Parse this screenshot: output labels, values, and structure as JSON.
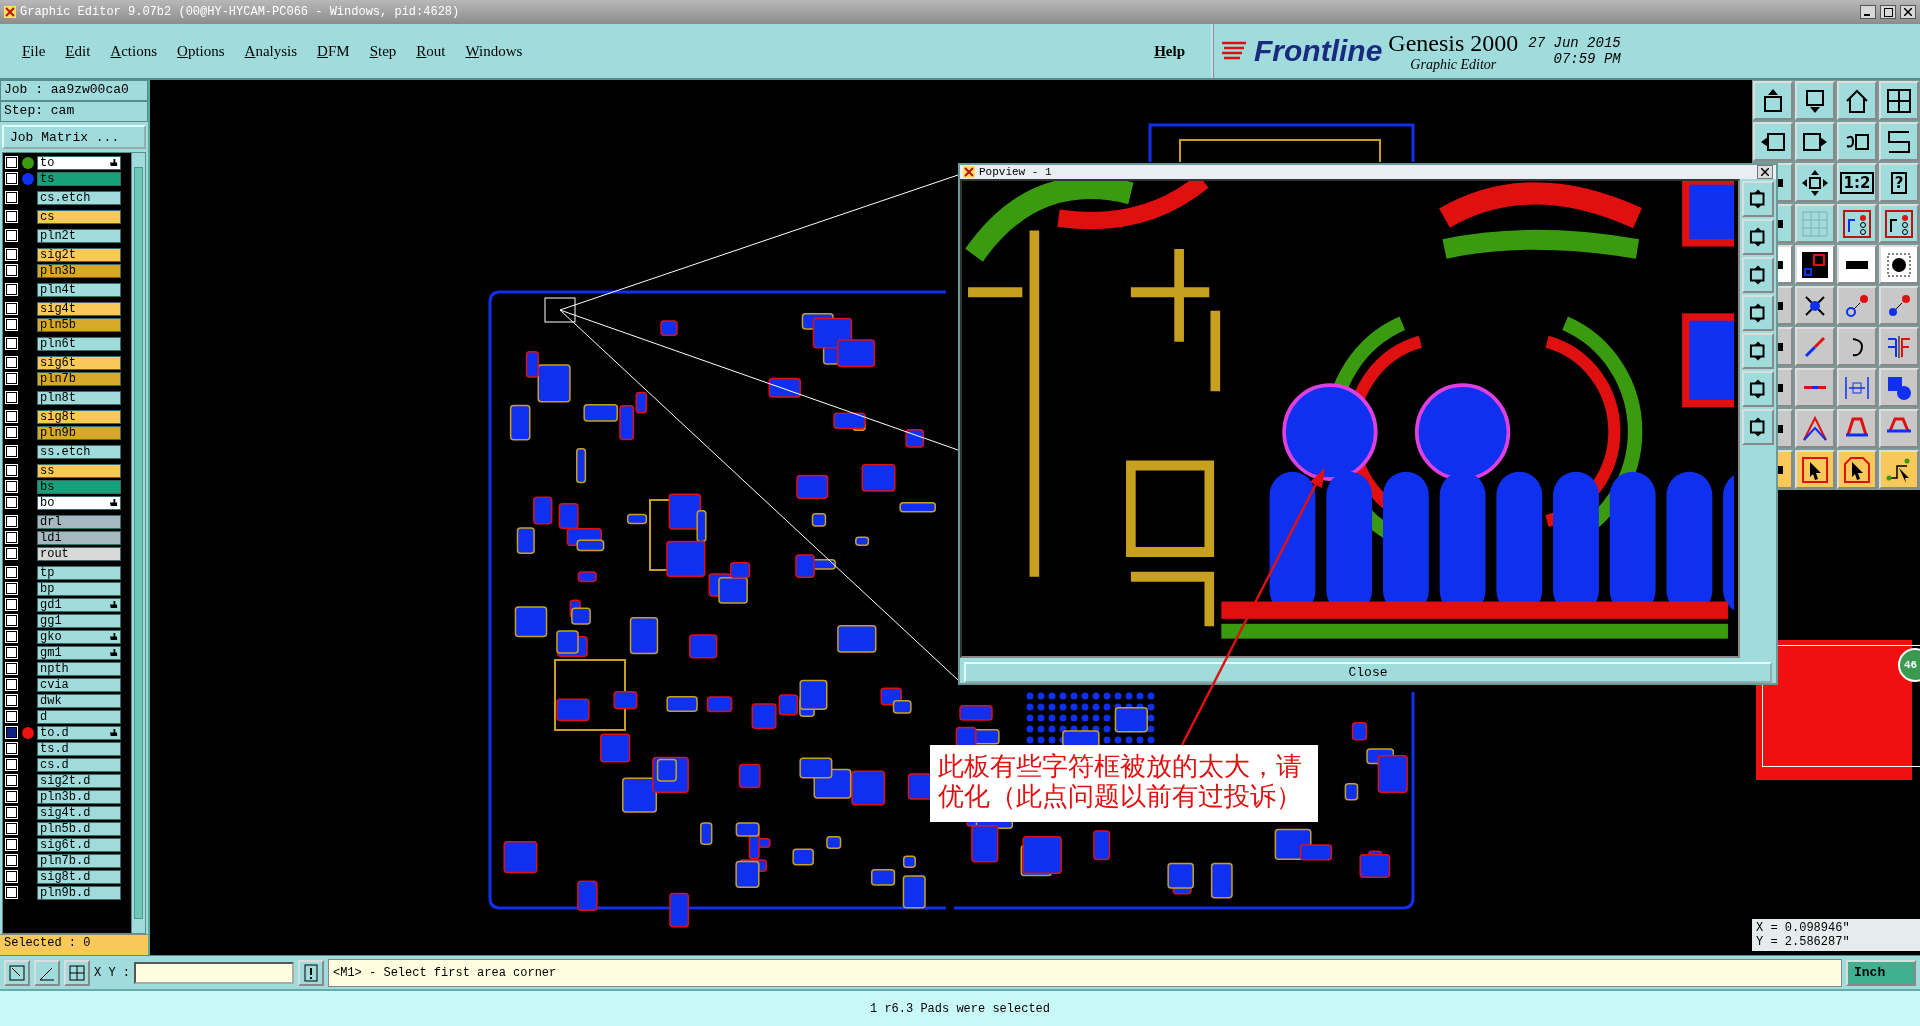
{
  "window": {
    "title": "Graphic Editor 9.07b2 (00@HY-HYCAM-PC066 - Windows, pid:4628)"
  },
  "menu": [
    "File",
    "Edit",
    "Actions",
    "Options",
    "Analysis",
    "DFM",
    "Step",
    "Rout",
    "Windows"
  ],
  "help": "Help",
  "brand": {
    "logo": "Frontline",
    "product": "Genesis 2000",
    "subtitle": "Graphic Editor",
    "date": "27 Jun 2015",
    "time": "07:59 PM"
  },
  "job": {
    "job": "Job : aa9zw00ca0",
    "step": "Step: cam",
    "matrix_button": "Job Matrix ..."
  },
  "layer_groups": [
    {
      "layers": [
        {
          "name": "to",
          "kind": "component",
          "color": "#3a9a10",
          "hand": true,
          "checked": false
        },
        {
          "name": "ts",
          "kind": "mask",
          "color": "#1030f0",
          "hand": false,
          "checked": false
        }
      ]
    },
    {
      "layers": [
        {
          "name": "cs.etch",
          "kind": "doc",
          "hand": false,
          "checked": false
        }
      ]
    },
    {
      "layers": [
        {
          "name": "cs",
          "kind": "signal",
          "hand": false,
          "checked": false
        }
      ]
    },
    {
      "layers": [
        {
          "name": "pln2t",
          "kind": "doc",
          "hand": false,
          "checked": false
        }
      ]
    },
    {
      "layers": [
        {
          "name": "sig2t",
          "kind": "signal",
          "hand": false,
          "checked": false
        },
        {
          "name": "pln3b",
          "kind": "plane",
          "hand": false,
          "checked": false
        }
      ]
    },
    {
      "layers": [
        {
          "name": "pln4t",
          "kind": "doc",
          "hand": false,
          "checked": false
        }
      ]
    },
    {
      "layers": [
        {
          "name": "sig4t",
          "kind": "signal",
          "hand": false,
          "checked": false
        },
        {
          "name": "pln5b",
          "kind": "plane",
          "hand": false,
          "checked": false
        }
      ]
    },
    {
      "layers": [
        {
          "name": "pln6t",
          "kind": "doc",
          "hand": false,
          "checked": false
        }
      ]
    },
    {
      "layers": [
        {
          "name": "sig6t",
          "kind": "signal",
          "hand": false,
          "checked": false
        },
        {
          "name": "pln7b",
          "kind": "plane",
          "hand": false,
          "checked": false
        }
      ]
    },
    {
      "layers": [
        {
          "name": "pln8t",
          "kind": "doc",
          "hand": false,
          "checked": false
        }
      ]
    },
    {
      "layers": [
        {
          "name": "sig8t",
          "kind": "signal",
          "hand": false,
          "checked": false
        },
        {
          "name": "pln9b",
          "kind": "plane",
          "hand": false,
          "checked": false
        }
      ]
    },
    {
      "layers": [
        {
          "name": "ss.etch",
          "kind": "doc",
          "hand": false,
          "checked": false
        }
      ]
    },
    {
      "layers": [
        {
          "name": "ss",
          "kind": "signal",
          "hand": false,
          "checked": false
        },
        {
          "name": "bs",
          "kind": "mask",
          "hand": false,
          "checked": false
        },
        {
          "name": "bo",
          "kind": "component",
          "hand": true,
          "checked": false
        }
      ]
    },
    {
      "layers": [
        {
          "name": "drl",
          "kind": "drill",
          "hand": false,
          "checked": false
        },
        {
          "name": "ldi",
          "kind": "drill",
          "hand": false,
          "checked": false
        },
        {
          "name": "rout",
          "kind": "rout",
          "hand": false,
          "checked": false
        }
      ]
    },
    {
      "layers": [
        {
          "name": "tp",
          "kind": "doc",
          "hand": false,
          "checked": false
        },
        {
          "name": "bp",
          "kind": "doc",
          "hand": false,
          "checked": false
        },
        {
          "name": "gd1",
          "kind": "doc",
          "hand": true,
          "checked": false
        },
        {
          "name": "gg1",
          "kind": "doc",
          "hand": false,
          "checked": false
        },
        {
          "name": "gko",
          "kind": "doc",
          "hand": true,
          "checked": false
        },
        {
          "name": "gm1",
          "kind": "doc",
          "hand": true,
          "checked": false
        },
        {
          "name": "npth",
          "kind": "doc",
          "hand": false,
          "checked": false
        },
        {
          "name": "cvia",
          "kind": "doc",
          "hand": false,
          "checked": false
        },
        {
          "name": "dwk",
          "kind": "doc",
          "hand": false,
          "checked": false
        },
        {
          "name": "d",
          "kind": "doc",
          "hand": false,
          "checked": false
        },
        {
          "name": "to.d",
          "kind": "doc",
          "color": "#f01010",
          "hand": true,
          "checked": true
        },
        {
          "name": "ts.d",
          "kind": "doc",
          "hand": false,
          "checked": false
        },
        {
          "name": "cs.d",
          "kind": "doc",
          "hand": false,
          "checked": false
        },
        {
          "name": "sig2t.d",
          "kind": "doc",
          "hand": false,
          "checked": false
        },
        {
          "name": "pln3b.d",
          "kind": "doc",
          "hand": false,
          "checked": false
        },
        {
          "name": "sig4t.d",
          "kind": "doc",
          "hand": false,
          "checked": false
        },
        {
          "name": "pln5b.d",
          "kind": "doc",
          "hand": false,
          "checked": false
        },
        {
          "name": "sig6t.d",
          "kind": "doc",
          "hand": false,
          "checked": false
        },
        {
          "name": "pln7b.d",
          "kind": "doc",
          "hand": false,
          "checked": false
        },
        {
          "name": "sig8t.d",
          "kind": "doc",
          "hand": false,
          "checked": false
        },
        {
          "name": "pln9b.d",
          "kind": "doc",
          "hand": false,
          "checked": false
        }
      ]
    }
  ],
  "selected_count": "Selected : 0",
  "toolbar": {
    "scale_label": "1:2",
    "help_label": "?"
  },
  "canvas": {
    "badge": "46"
  },
  "popview": {
    "title": "Popview - 1",
    "close": "Close"
  },
  "note": "此板有些字符框被放的太大，请优化（此点问题以前有过投诉）",
  "coordinates": {
    "x": "X = 0.098946\"",
    "y": "Y = 2.586287\""
  },
  "command_bar": {
    "xy_label": "X Y :",
    "prompt": "<M1> - Select first area corner",
    "unit": "Inch"
  },
  "status_bar": "1 r6.3 Pads were selected"
}
